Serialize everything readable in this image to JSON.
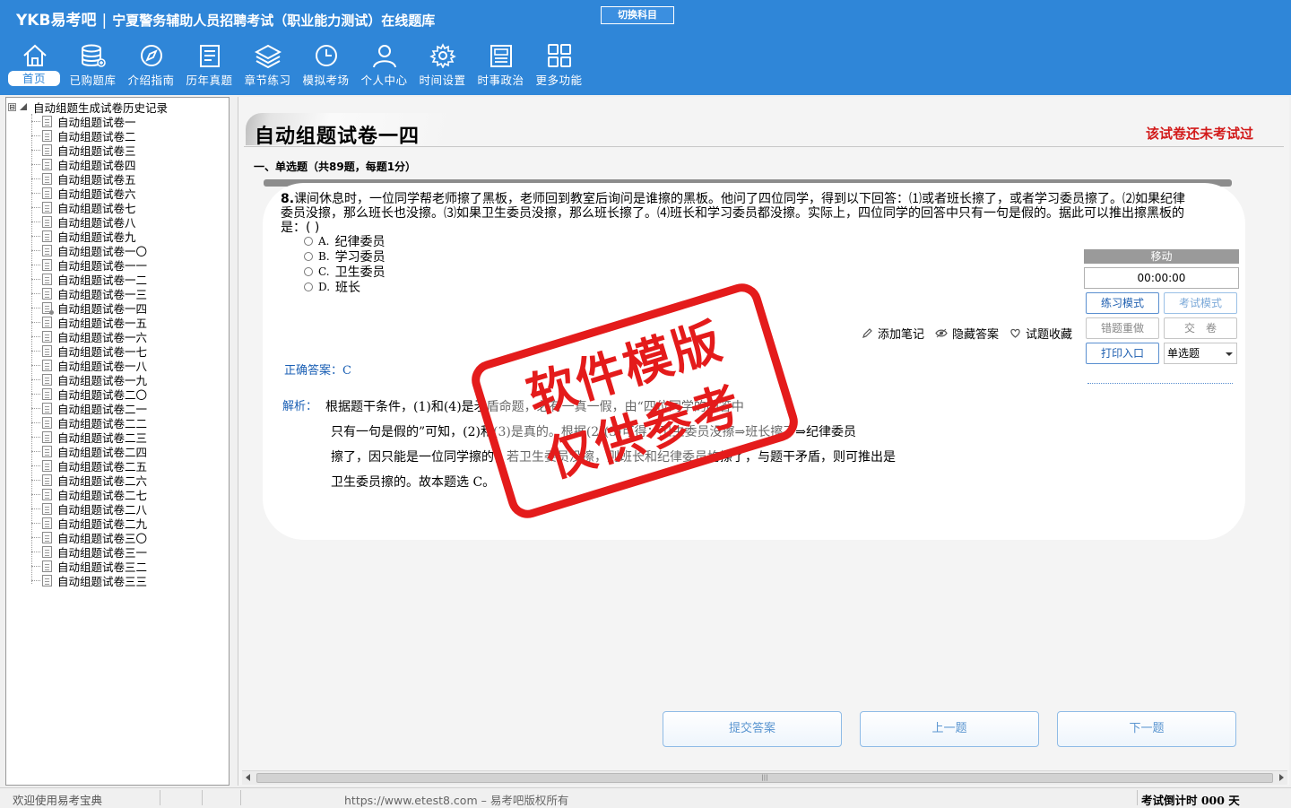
{
  "header": {
    "brand": "YKB易考吧",
    "separator": "|",
    "app_title": "宁夏警务辅助人员招聘考试（职业能力测试）在线题库",
    "switch_subject": "切换科目"
  },
  "nav": [
    {
      "label": "首页",
      "icon": "home-icon"
    },
    {
      "label": "已购题库",
      "icon": "database-icon"
    },
    {
      "label": "介绍指南",
      "icon": "compass-icon"
    },
    {
      "label": "历年真题",
      "icon": "document-list-icon"
    },
    {
      "label": "章节练习",
      "icon": "layers-icon"
    },
    {
      "label": "模拟考场",
      "icon": "clock-icon"
    },
    {
      "label": "个人中心",
      "icon": "user-icon"
    },
    {
      "label": "时间设置",
      "icon": "gear-icon"
    },
    {
      "label": "时事政治",
      "icon": "newspaper-icon"
    },
    {
      "label": "更多功能",
      "icon": "grid-icon"
    }
  ],
  "tree": {
    "root_label": "自动组题生成试卷历史记录",
    "expander": "⊟",
    "items": [
      "自动组题试卷一",
      "自动组题试卷二",
      "自动组题试卷三",
      "自动组题试卷四",
      "自动组题试卷五",
      "自动组题试卷六",
      "自动组题试卷七",
      "自动组题试卷八",
      "自动组题试卷九",
      "自动组题试卷一〇",
      "自动组题试卷一一",
      "自动组题试卷一二",
      "自动组题试卷一三",
      "自动组题试卷一四",
      "自动组题试卷一五",
      "自动组题试卷一六",
      "自动组题试卷一七",
      "自动组题试卷一八",
      "自动组题试卷一九",
      "自动组题试卷二〇",
      "自动组题试卷二一",
      "自动组题试卷二二",
      "自动组题试卷二三",
      "自动组题试卷二四",
      "自动组题试卷二五",
      "自动组题试卷二六",
      "自动组题试卷二七",
      "自动组题试卷二八",
      "自动组题试卷二九",
      "自动组题试卷三〇",
      "自动组题试卷三一",
      "自动组题试卷三二",
      "自动组题试卷三三"
    ]
  },
  "exam": {
    "title": "自动组题试卷一四",
    "status": "该试卷还未考试过",
    "section_header": "一、单选题（共89题，每题1分）"
  },
  "question": {
    "number": "8.",
    "text": "课间休息时，一位同学帮老师擦了黑板，老师回到教室后询问是谁擦的黑板。他问了四位同学，得到以下回答：⑴或者班长擦了，或者学习委员擦了。⑵如果纪律委员没擦，那么班长也没擦。⑶如果卫生委员没擦，那么班长擦了。⑷班长和学习委员都没擦。实际上，四位同学的回答中只有一句是假的。据此可以推出擦黑板的是：( )",
    "options": [
      {
        "letter": "A.",
        "text": "纪律委员"
      },
      {
        "letter": "B.",
        "text": "学习委员"
      },
      {
        "letter": "C.",
        "text": "卫生委员"
      },
      {
        "letter": "D.",
        "text": "班长"
      }
    ],
    "actions": {
      "add_note": "添加笔记",
      "hide_answer": "隐藏答案",
      "favorite": "试题收藏"
    },
    "answer_label": "正确答案：",
    "answer_value": "C",
    "analysis_label": "解析：",
    "analysis_lines": [
      "根据题干条件，(1)和(4)是矛盾命题，必有一真一假，由“四位同学的回答中",
      "只有一句是假的”可知，(2)和(3)是真的。根据(2)(3)可得：卫生委员没擦⇒班长擦了⇒纪律委员",
      "擦了，因只能是一位同学擦的，若卫生委员没擦，则班长和纪律委员均擦了，与题干矛盾，则可推出是",
      "卫生委员擦的。故本题选 C。"
    ]
  },
  "side_panel": {
    "move": "移动",
    "timer": "00:00:00",
    "practice_mode": "练习模式",
    "exam_mode": "考试模式",
    "redo_wrong": "错题重做",
    "submit_paper": "交　卷",
    "print_entry": "打印入口",
    "question_type": "单选题"
  },
  "buttons": {
    "submit": "提交答案",
    "prev": "上一题",
    "next": "下一题"
  },
  "watermark": "软件模版 仅供参考",
  "statusbar": {
    "welcome": "欢迎使用易考宝典",
    "copyright": "https://www.etest8.com – 易考吧版权所有",
    "countdown": "考试倒计时 000 天"
  },
  "colors": {
    "header_bg": "#2f86d8",
    "status_red": "#d21a1a",
    "answer_blue": "#1a5fb4",
    "stamp_red": "#e41b1b"
  }
}
